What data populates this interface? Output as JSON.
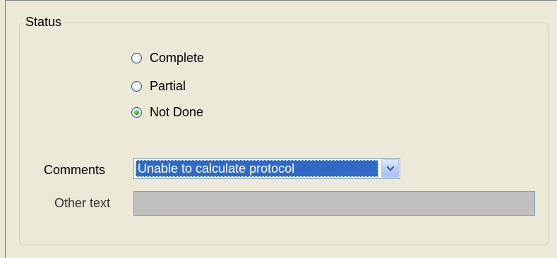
{
  "status_group": {
    "title": "Status",
    "options": [
      {
        "label": "Complete",
        "selected": false
      },
      {
        "label": "Partial",
        "selected": false
      },
      {
        "label": "Not Done",
        "selected": true
      }
    ]
  },
  "comments": {
    "label": "Comments",
    "selected_value": "Unable to calculate protocol",
    "dropdown_icon": "chevron-down-icon"
  },
  "other_text": {
    "label": "Other text",
    "value": ""
  },
  "colors": {
    "background": "#ece9d8",
    "selection": "#316ac5",
    "radio_dot": "#2fa52f",
    "disabled_field": "#c0c0c0"
  }
}
